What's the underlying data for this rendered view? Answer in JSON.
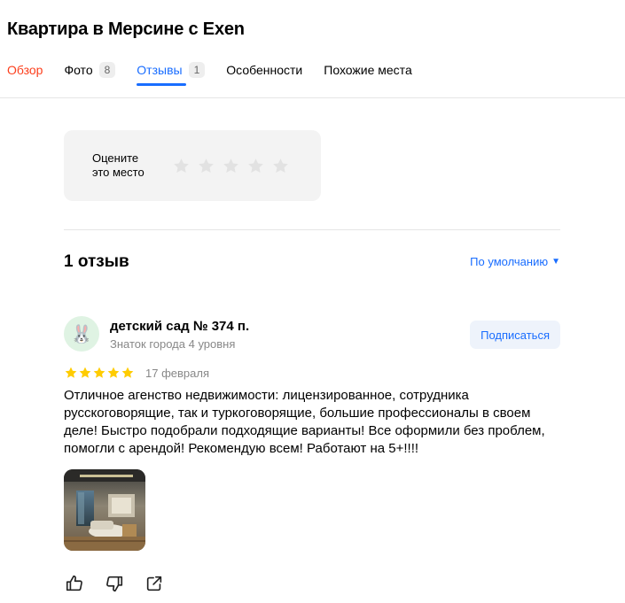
{
  "header": {
    "title": "Квартира в Мерсине с Exen"
  },
  "tabs": [
    {
      "label": "Обзор",
      "count": null
    },
    {
      "label": "Фото",
      "count": "8"
    },
    {
      "label": "Отзывы",
      "count": "1"
    },
    {
      "label": "Особенности",
      "count": null
    },
    {
      "label": "Похожие места",
      "count": null
    }
  ],
  "active_tab": "Отзывы",
  "rate_prompt": {
    "line1": "Оцените",
    "line2": "это место",
    "stars_total": 5,
    "stars_selected": 0
  },
  "reviews_header": {
    "count_label": "1 отзыв",
    "sort_label": "По умолчанию"
  },
  "review": {
    "author": "детский сад № 374 п.",
    "author_level": "Знаток города 4 уровня",
    "avatar_icon": "rabbit-emoji",
    "avatar_emoji": "🐰",
    "subscribe_label": "Подписаться",
    "rating": 5,
    "date": "17 февраля",
    "text": "Отличное агенство недвижимости: лицензированное, сотрудника русскоговорящие, так и туркоговорящие, большие профессионалы в своем деле! Быстро подобрали подходящие варианты! Все оформили без проблем, помогли с арендой! Рекомендую всем! Работают на 5+!!!!",
    "actions": [
      "like-icon",
      "dislike-icon",
      "share-icon"
    ]
  },
  "colors": {
    "accent": "#196dff",
    "overview_tab": "#fc3f1d",
    "star_filled": "#fc0",
    "star_empty": "#e2e2e2",
    "muted_text": "#888888"
  }
}
